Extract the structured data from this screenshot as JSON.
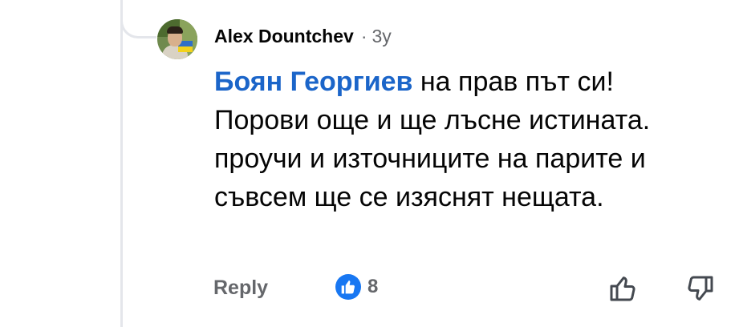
{
  "comment": {
    "author": "Alex Dountchev",
    "separator": "·",
    "time": "3y",
    "mention": "Боян Георгиев",
    "text": " на прав път си! Порови още и ще лъсне истината. проучи и източниците на парите и съвсем ще се изяснят нещата."
  },
  "actions": {
    "reply_label": "Reply",
    "like_count": "8"
  },
  "icons": {
    "like": "thumbs-up-icon",
    "upvote": "thumbs-up-outline-icon",
    "downvote": "thumbs-down-outline-icon"
  },
  "colors": {
    "mention": "#1b65c9",
    "like_badge": "#1877f2",
    "muted_text": "#65676b",
    "thread_line": "#e4e6eb"
  }
}
